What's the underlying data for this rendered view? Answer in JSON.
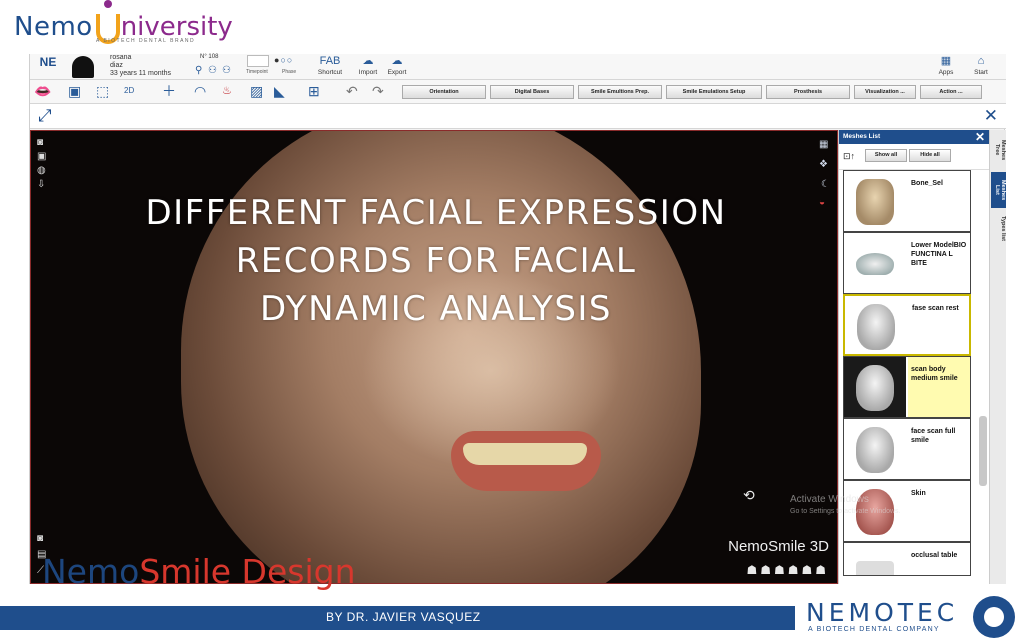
{
  "brand": {
    "nemo": "Nemo",
    "university": "niversity",
    "tagline": "A BIOTECH DENTAL BRAND"
  },
  "patient": {
    "initials": "NE",
    "first_name": "rosana",
    "last_name": "diaz",
    "age": "33 years 11 months",
    "number": "N° 108"
  },
  "toolbar": {
    "timepoint_label": "Timepoint",
    "phase_label": "Phase",
    "shortcut_label": "Shortcut",
    "import_label": "Import",
    "export_label": "Export",
    "apps_label": "Apps",
    "start_label": "Start",
    "fab_label": "FAB",
    "menu": [
      "Orientation",
      "Digital Bases",
      "Smile Emultions Prep.",
      "Smile Emulations Setup",
      "Prosthesis",
      "Visualization ...",
      "Action ..."
    ],
    "two_d": "2D"
  },
  "viewport": {
    "overlay_line1": "DIFFERENT FACIAL EXPRESSION",
    "overlay_line2": "RECORDS  FOR FACIAL",
    "overlay_line3": "DYNAMIC ANALYSIS",
    "product": "NemoSmile 3D",
    "activate_title": "Activate Windows",
    "activate_sub": "Go to Settings to activate Windows."
  },
  "meshes": {
    "title": "Meshes List",
    "show_all": "Show all",
    "hide_all": "Hide all",
    "items": [
      {
        "label": "Bone_Sel"
      },
      {
        "label": "Lower ModelBIO FUNCTINA L BITE"
      },
      {
        "label": "fase scan rest"
      },
      {
        "label": "scan body medium smile"
      },
      {
        "label": "face scan full smile"
      },
      {
        "label": "Skin"
      },
      {
        "label": "occlusal table"
      }
    ]
  },
  "side_tabs": [
    "Meshes Tree",
    "Meshes List",
    "Types list"
  ],
  "footer": {
    "smile_logo_part1": "Nemo",
    "smile_logo_part2": "Smile Design",
    "author": "BY  DR. JAVIER VASQUEZ",
    "company": "NEMOTEC",
    "company_sub": "A BIOTECH DENTAL COMPANY"
  },
  "colors": {
    "brand_blue": "#1f4e8c",
    "accent_red": "#d7372d",
    "university_purple": "#8c2a8c",
    "university_orange": "#f2a31b"
  }
}
